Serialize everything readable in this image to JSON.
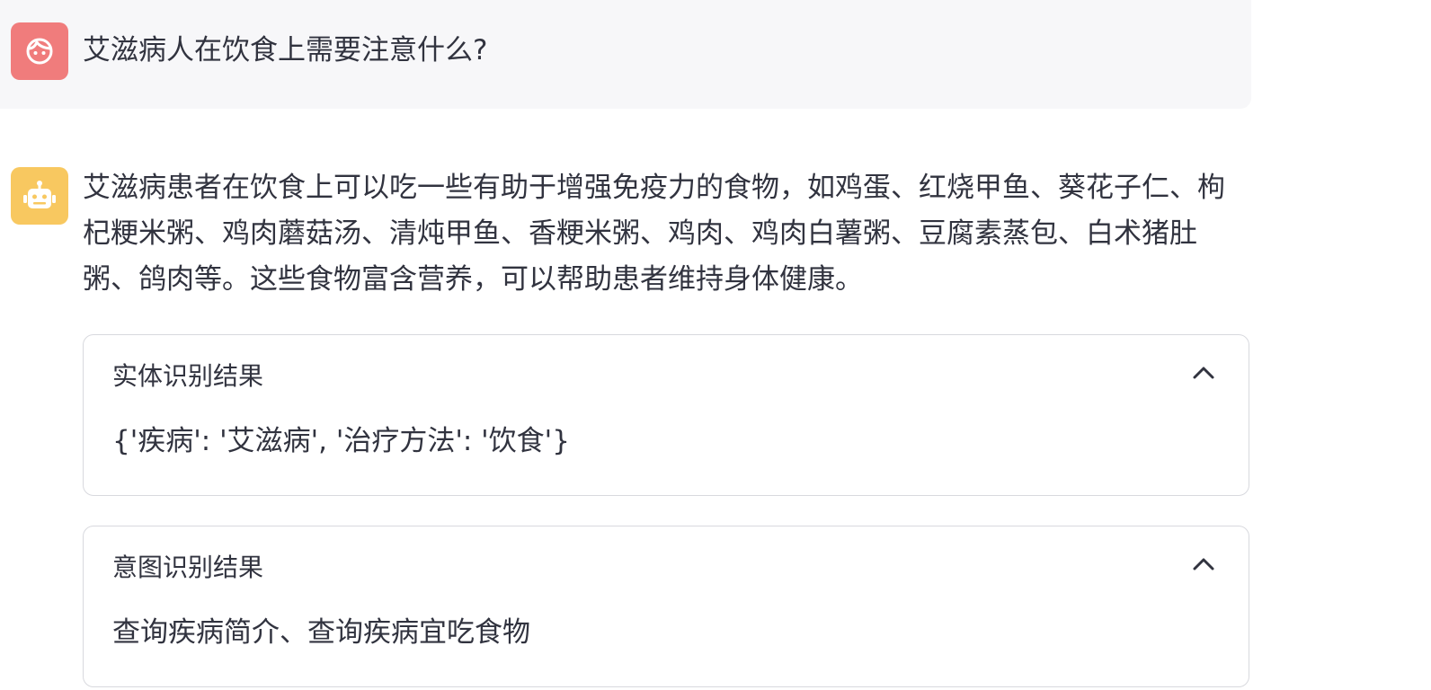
{
  "chat": {
    "user_message": "艾滋病人在饮食上需要注意什么?",
    "assistant_message": "艾滋病患者在饮食上可以吃一些有助于增强免疫力的食物，如鸡蛋、红烧甲鱼、葵花子仁、枸杞粳米粥、鸡肉蘑菇汤、清炖甲鱼、香粳米粥、鸡肉、鸡肉白薯粥、豆腐素蒸包、白术猪肚粥、鸽肉等。这些食物富含营养，可以帮助患者维持身体健康。"
  },
  "expanders": {
    "entity": {
      "title": "实体识别结果",
      "content": "{'疾病': '艾滋病', '治疗方法': '饮食'}"
    },
    "intent": {
      "title": "意图识别结果",
      "content": "查询疾病简介、查询疾病宜吃食物"
    }
  },
  "icons": {
    "user_avatar": "user-face-icon",
    "assistant_avatar": "robot-icon",
    "collapse": "chevron-up-icon"
  },
  "colors": {
    "user_avatar_bg": "#f07c7c",
    "assistant_avatar_bg": "#f8c860",
    "user_row_bg": "#f7f7f9"
  }
}
